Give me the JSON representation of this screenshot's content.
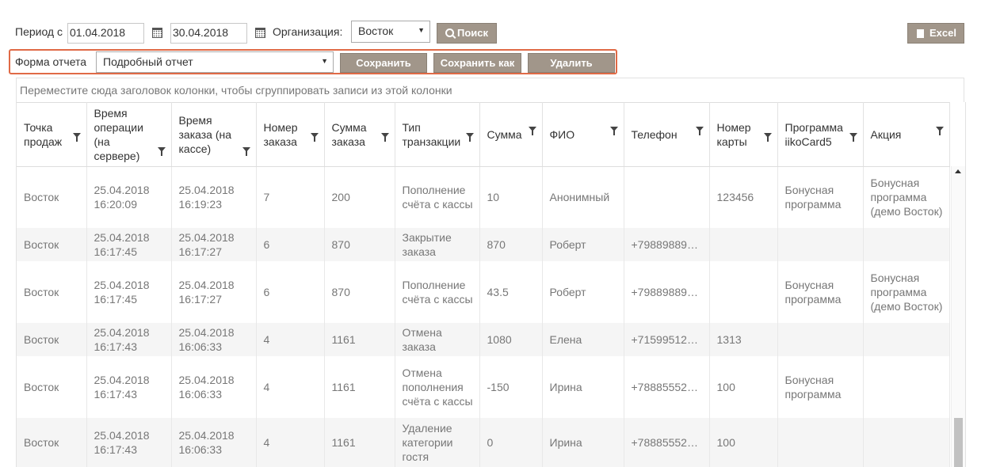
{
  "filters": {
    "period_label": "Период с",
    "date_from": "01.04.2018",
    "date_to": "30.04.2018",
    "org_label": "Организация:",
    "org_value": "Восток",
    "search_button": "Поиск",
    "excel_button": "Excel"
  },
  "report_form": {
    "label": "Форма отчета",
    "value": "Подробный отчет",
    "save": "Сохранить",
    "save_as": "Сохранить как",
    "delete": "Удалить"
  },
  "group_hint": "Переместите сюда заголовок колонки, чтобы сгруппировать записи из этой колонки",
  "columns": [
    "Точка продаж",
    "Время операции (на сервере)",
    "Время заказа (на кассе)",
    "Номер заказа",
    "Сумма заказа",
    "Тип транзакции",
    "Сумма",
    "ФИО",
    "Телефон",
    "Номер карты",
    "Программа iikoCard5",
    "Акция"
  ],
  "rows": [
    [
      "Восток",
      "25.04.2018 16:20:09",
      "25.04.2018 16:19:23",
      "7",
      "200",
      "Пополнение счёта с кассы",
      "10",
      "Анонимный",
      "",
      "123456",
      "Бонусная программа",
      "Бонусная программа (демо Восток)"
    ],
    [
      "Восток",
      "25.04.2018 16:17:45",
      "25.04.2018 16:17:27",
      "6",
      "870",
      "Закрытие заказа",
      "870",
      "Роберт",
      "+79889889…",
      "",
      "",
      ""
    ],
    [
      "Восток",
      "25.04.2018 16:17:45",
      "25.04.2018 16:17:27",
      "6",
      "870",
      "Пополнение счёта с кассы",
      "43.5",
      "Роберт",
      "+79889889…",
      "",
      "Бонусная программа",
      "Бонусная программа (демо Восток)"
    ],
    [
      "Восток",
      "25.04.2018 16:17:43",
      "25.04.2018 16:06:33",
      "4",
      "1161",
      "Отмена заказа",
      "1080",
      "Елена",
      "+71599512…",
      "1313",
      "",
      ""
    ],
    [
      "Восток",
      "25.04.2018 16:17:43",
      "25.04.2018 16:06:33",
      "4",
      "1161",
      "Отмена пополнения счёта с кассы",
      "-150",
      "Ирина",
      "+78885552…",
      "100",
      "Бонусная программа",
      ""
    ],
    [
      "Восток",
      "25.04.2018 16:17:43",
      "25.04.2018 16:06:33",
      "4",
      "1161",
      "Удаление категории гостя",
      "0",
      "Ирина",
      "+78885552…",
      "100",
      "",
      ""
    ]
  ]
}
